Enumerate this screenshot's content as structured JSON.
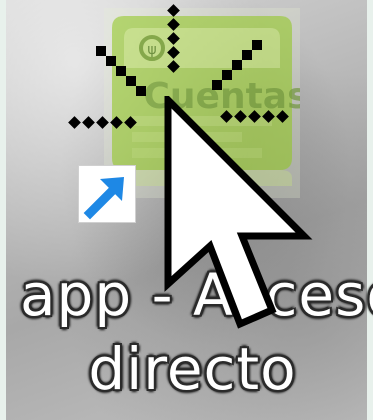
{
  "desktop": {
    "shortcut": {
      "label_line1": "app - Acceso",
      "label_line2": "directo",
      "app_icon": "app-logo-icon",
      "overlay_icon": "shortcut-arrow-icon",
      "app_icon_text": "Cuentas"
    },
    "cursor": {
      "pointer_icon": "arrow-pointer-icon",
      "busy_icon": "busy-spinner-icon"
    }
  },
  "colors": {
    "app_icon_green": "#9acd32",
    "shortcut_arrow_blue": "#1e88e5",
    "label_text": "#ffffff"
  }
}
